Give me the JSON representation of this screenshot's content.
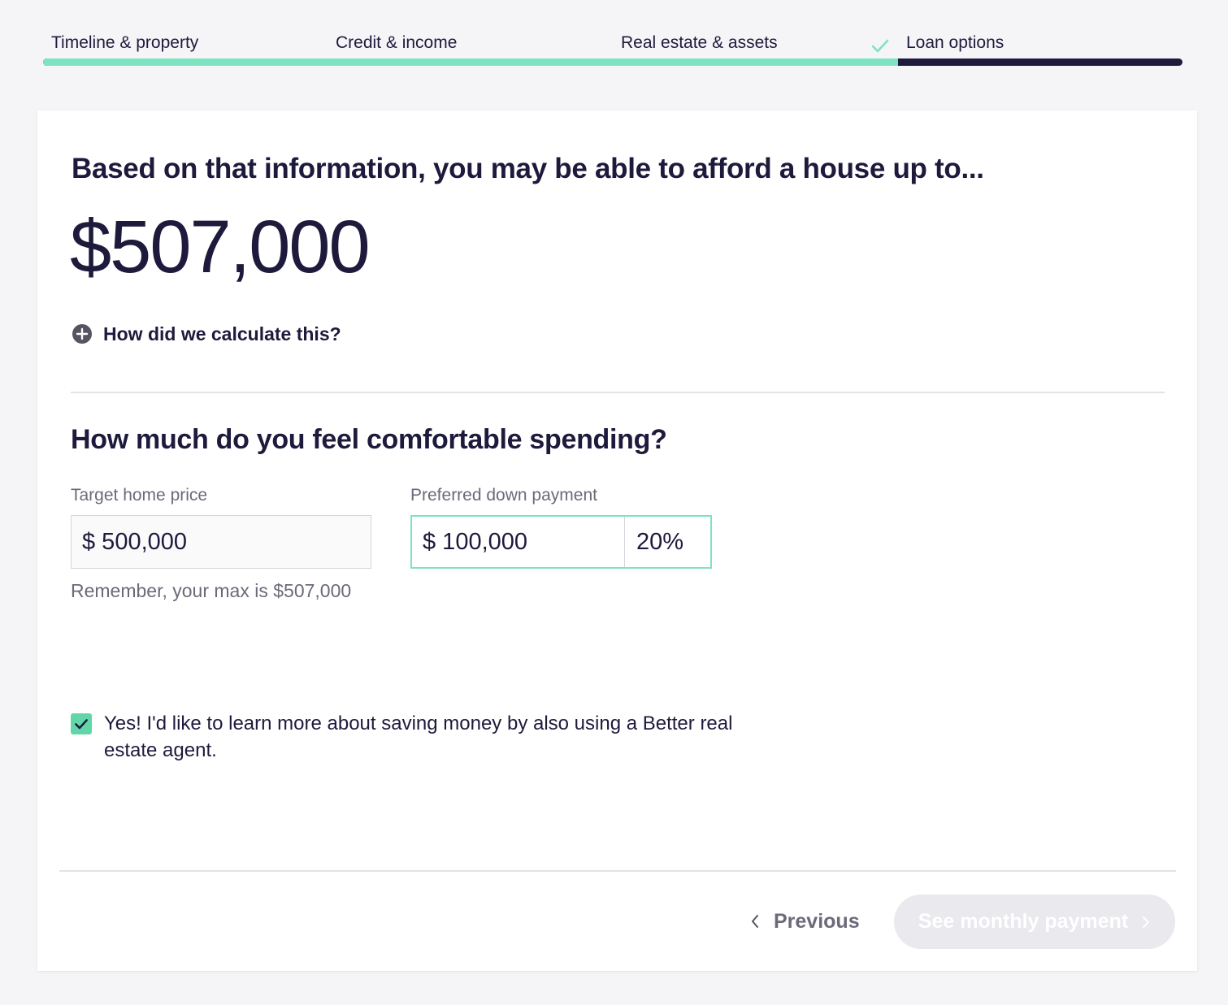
{
  "steps": [
    {
      "label": "Timeline & property"
    },
    {
      "label": "Credit & income"
    },
    {
      "label": "Real estate & assets"
    },
    {
      "label": "Loan options"
    }
  ],
  "progress_fraction": 0.75,
  "colors": {
    "accent": "#7de3c1",
    "checkbox": "#62d6a8",
    "dark": "#1e1a3c",
    "muted": "#6b6a7a",
    "disabled_button": "#e9e9ee"
  },
  "result": {
    "headline": "Based on that information, you may be able to afford a house up to...",
    "amount": "$507,000",
    "calc_link": "How did we calculate this?"
  },
  "spending": {
    "title": "How much do you feel comfortable spending?",
    "target_label": "Target home price",
    "target_value": "$ 500,000",
    "target_hint": "Remember, your max is $507,000",
    "down_label": "Preferred down payment",
    "down_value": "$ 100,000",
    "down_percent": "20%"
  },
  "agent_optin": {
    "checked": true,
    "text": "Yes! I'd like to learn more about saving money by also using a Better real estate agent."
  },
  "nav": {
    "previous": "Previous",
    "next": "See monthly payment"
  },
  "icons": {
    "step_done": "check-icon",
    "calc": "plus-circle-icon",
    "previous": "chevron-left-icon",
    "next": "chevron-right-icon",
    "checkbox": "check-icon"
  }
}
